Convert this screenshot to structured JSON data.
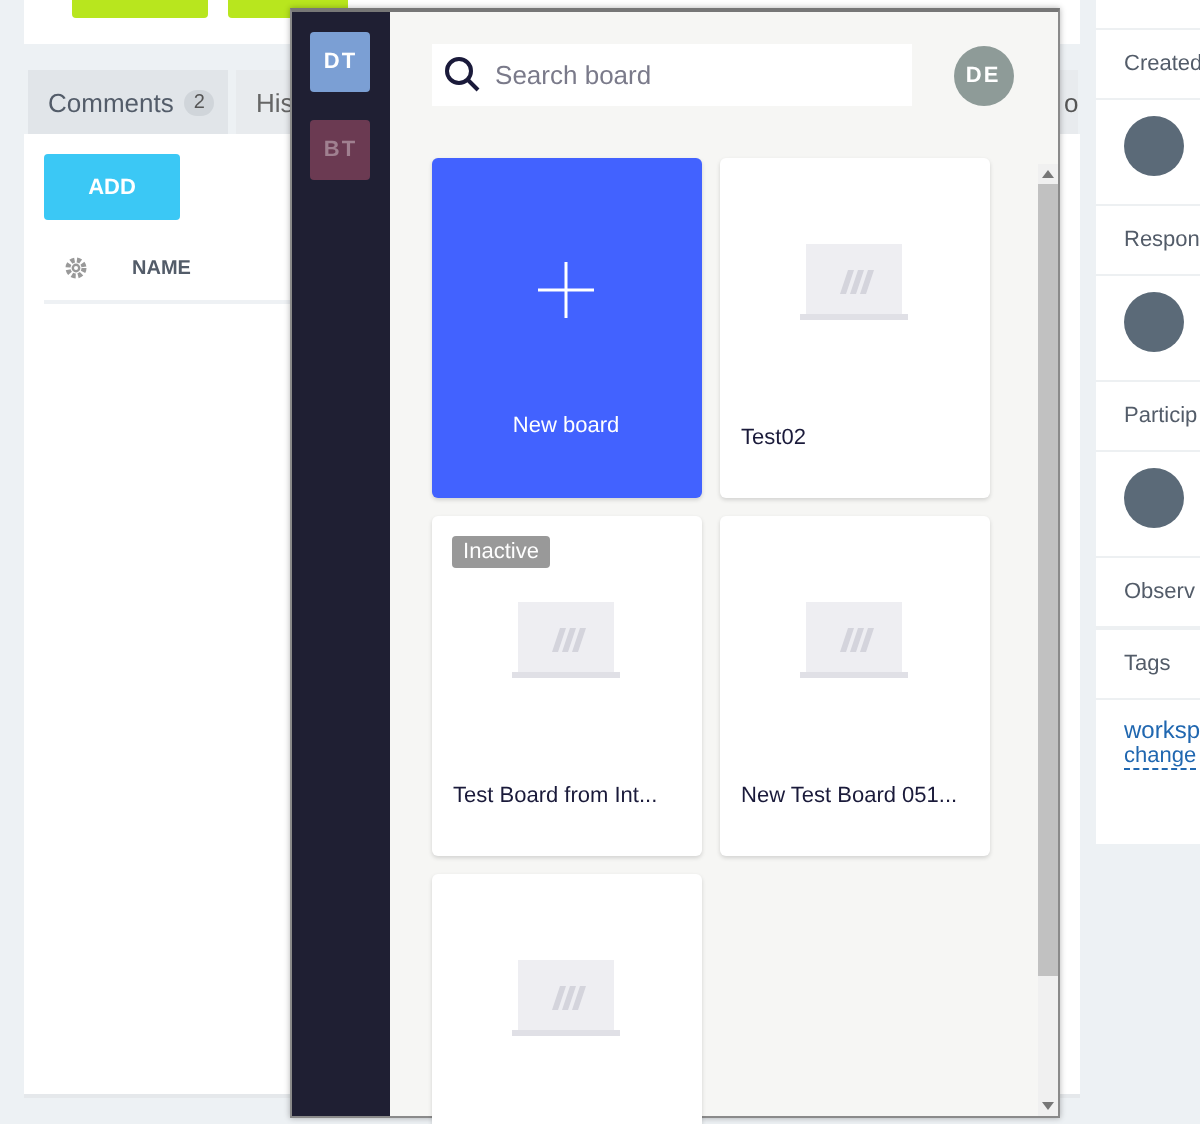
{
  "page": {
    "tabs": [
      {
        "label": "Comments",
        "count": "2",
        "selected": true
      },
      {
        "label": "His",
        "selected": false
      },
      {
        "label": "o",
        "selected": false
      }
    ],
    "add_button": "ADD",
    "columns": [
      "NAME"
    ]
  },
  "details": {
    "sections": [
      {
        "label": "Created",
        "kind": "person"
      },
      {
        "label": "Respon",
        "kind": "person"
      },
      {
        "label": "Particip",
        "kind": "person"
      },
      {
        "label": "Observ",
        "kind": "empty"
      },
      {
        "label": "Tags",
        "kind": "tags",
        "link": "worksp",
        "action": "change"
      }
    ]
  },
  "board_picker": {
    "workspaces": [
      {
        "initials": "DT",
        "color": "#7b9fd4",
        "selected": true
      },
      {
        "initials": "BT",
        "color": "#6b3a52",
        "selected": false
      }
    ],
    "search": {
      "placeholder": "Search board"
    },
    "user_initials": "DE",
    "boards": [
      {
        "kind": "new",
        "title": "New board"
      },
      {
        "kind": "board",
        "title": "Test02",
        "inactive": false
      },
      {
        "kind": "board",
        "title": "Test Board from Int...",
        "inactive": true,
        "badge": "Inactive"
      },
      {
        "kind": "board",
        "title": "New Test Board 051...",
        "inactive": false
      },
      {
        "kind": "board",
        "inactive": false
      }
    ]
  }
}
